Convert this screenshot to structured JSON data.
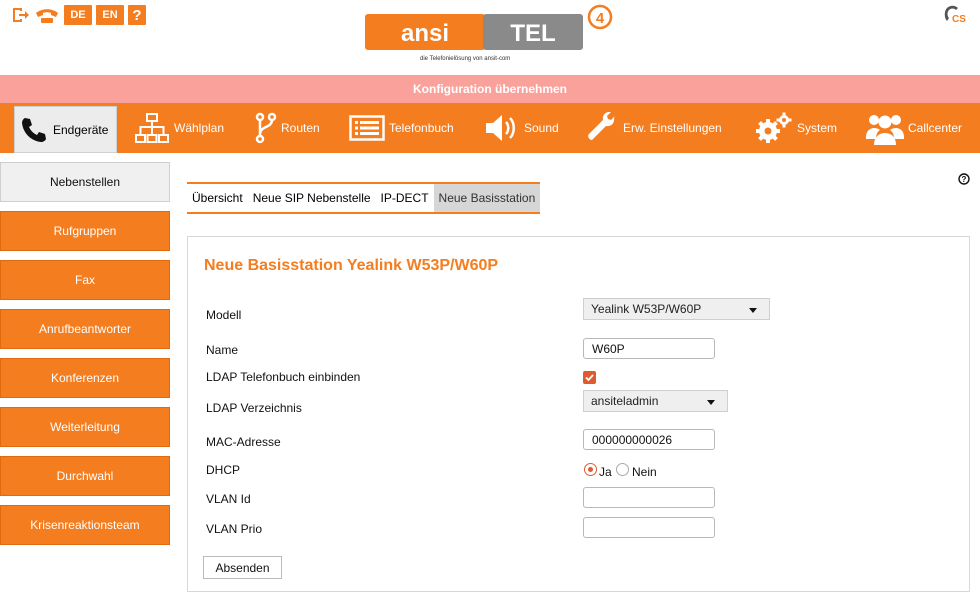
{
  "header": {
    "logo_text_left": "ansi",
    "logo_text_right": "TEL",
    "logo_version": "4",
    "logo_tagline": "die Telefonielösung von ansit-com",
    "lang_de": "DE",
    "lang_en": "EN",
    "help_glyph": "?",
    "cs_label": "CS"
  },
  "apply_bar": {
    "label": "Konfiguration übernehmen"
  },
  "nav": [
    {
      "label": "Endgeräte",
      "icon": "phone-icon",
      "active": true
    },
    {
      "label": "Wählplan",
      "icon": "sitemap-icon"
    },
    {
      "label": "Routen",
      "icon": "route-icon"
    },
    {
      "label": "Telefonbuch",
      "icon": "list-icon"
    },
    {
      "label": "Sound",
      "icon": "speaker-icon"
    },
    {
      "label": "Erw. Einstellungen",
      "icon": "wrench-icon"
    },
    {
      "label": "System",
      "icon": "gears-icon"
    },
    {
      "label": "Callcenter",
      "icon": "users-icon"
    }
  ],
  "sidebar": [
    {
      "label": "Nebenstellen",
      "active": true
    },
    {
      "label": "Rufgruppen"
    },
    {
      "label": "Fax"
    },
    {
      "label": "Anrufbeantworter"
    },
    {
      "label": "Konferenzen"
    },
    {
      "label": "Weiterleitung"
    },
    {
      "label": "Durchwahl"
    },
    {
      "label": "Krisenreaktionsteam"
    }
  ],
  "subtabs": [
    {
      "label": "Übersicht"
    },
    {
      "label": "Neue SIP Nebenstelle"
    },
    {
      "label": "IP-DECT"
    },
    {
      "label": "Neue Basisstation",
      "active": true
    }
  ],
  "form": {
    "title": "Neue Basisstation Yealink W53P/W60P",
    "modell_label": "Modell",
    "modell_value": "Yealink W53P/W60P",
    "name_label": "Name",
    "name_value": "W60P",
    "ldap_book_label": "LDAP Telefonbuch einbinden",
    "ldap_book_checked": true,
    "ldap_dir_label": "LDAP Verzeichnis",
    "ldap_dir_value": "ansiteladmin",
    "mac_label": "MAC-Adresse",
    "mac_value": "000000000026",
    "dhcp_label": "DHCP",
    "dhcp_yes": "Ja",
    "dhcp_no": "Nein",
    "dhcp_selected": "Ja",
    "vlan_id_label": "VLAN Id",
    "vlan_id_value": "",
    "vlan_prio_label": "VLAN Prio",
    "vlan_prio_value": "",
    "submit_label": "Absenden"
  },
  "colors": {
    "accent": "#f47d20",
    "apply_bar": "#f9a19a",
    "logo_gray": "#8a8a8a"
  }
}
